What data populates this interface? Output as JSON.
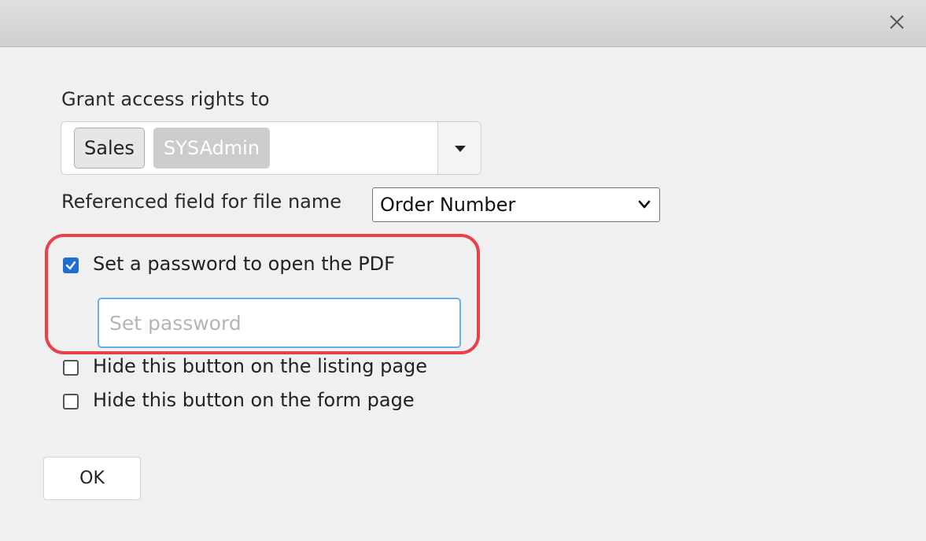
{
  "dialog": {
    "close_icon": "close-icon"
  },
  "access": {
    "label": "Grant access rights to",
    "tags": [
      "Sales",
      "SYSAdmin"
    ],
    "toggle_icon": "caret-down-icon"
  },
  "file_name": {
    "label": "Referenced field for file name",
    "selected": "Order Number"
  },
  "options": {
    "password": {
      "label": "Set a password to open the PDF",
      "checked": true,
      "input_placeholder": "Set password",
      "input_value": ""
    },
    "hide_listing": {
      "label": "Hide this button on the listing page",
      "checked": false
    },
    "hide_form": {
      "label": "Hide this button on the form page",
      "checked": false
    }
  },
  "footer": {
    "ok_label": "OK"
  },
  "colors": {
    "highlight": "#e8414a",
    "checkbox_accent": "#1f6fd1",
    "input_focus_border": "#6aaee6"
  }
}
